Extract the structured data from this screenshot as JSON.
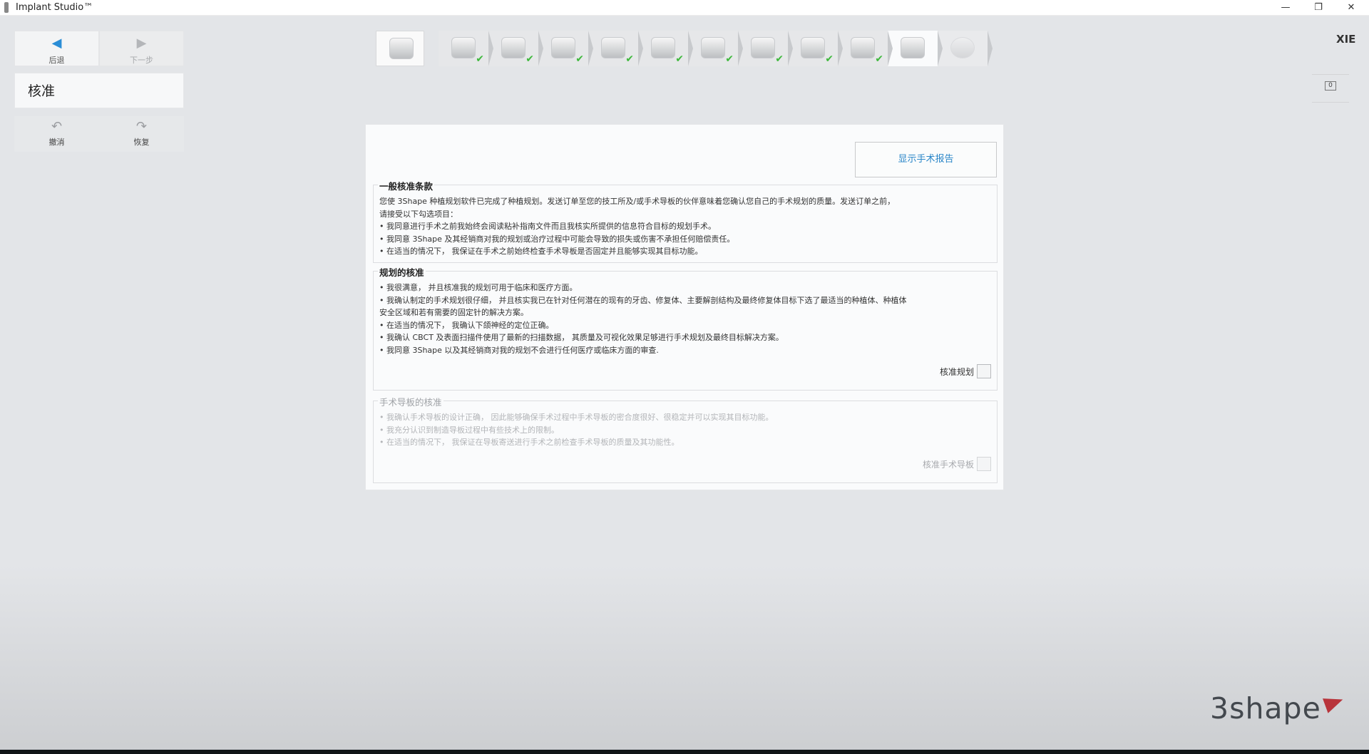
{
  "window": {
    "title": "Implant Studio™",
    "minimize": "—",
    "maximize": "❐",
    "close": "✕"
  },
  "nav": {
    "back_label": "后退",
    "next_label": "下一步",
    "back_icon": "arrow-left-icon",
    "next_icon": "arrow-right-icon"
  },
  "step_title": "核准",
  "edit": {
    "undo_label": "撤消",
    "redo_label": "恢复"
  },
  "workflow": {
    "steps": [
      {
        "name": "case-info",
        "done": false,
        "state": "first"
      },
      {
        "name": "patient-data",
        "done": true
      },
      {
        "name": "scan-import",
        "done": true
      },
      {
        "name": "tooth-model",
        "done": true
      },
      {
        "name": "panoramic",
        "done": true
      },
      {
        "name": "nerve-path",
        "done": true
      },
      {
        "name": "implant-placement",
        "done": true
      },
      {
        "name": "guide-design-1",
        "done": true
      },
      {
        "name": "sleeve",
        "done": true
      },
      {
        "name": "guide-support",
        "done": true
      },
      {
        "name": "approval",
        "done": false,
        "state": "current"
      },
      {
        "name": "export",
        "done": false,
        "state": "disabled"
      }
    ],
    "check_glyph": "✔"
  },
  "user": {
    "initials": "XIE",
    "messages": "0"
  },
  "main": {
    "report_button": "显示手术报告",
    "general": {
      "title": "一般核准条款",
      "lines": [
        "您使 3Shape 种植规划软件已完成了种植规划。发送订单至您的技工所及/或手术导板的伙伴意味着您确认您自己的手术规划的质量。发送订单之前，",
        "请接受以下勾选项目：",
        "• 我同意进行手术之前我始终会阅读粘补指南文件而且我核实所提供的信息符合目标的规划手术。",
        "• 我同意 3Shape 及其经销商对我的规划或治疗过程中可能会导致的损失或伤害不承担任何赔偿责任。",
        "• 在适当的情况下， 我保证在手术之前始终检查手术导板是否固定并且能够实现其目标功能。"
      ]
    },
    "planning": {
      "title": "规划的核准",
      "lines": [
        "• 我很满意， 并且核准我的规划可用于临床和医疗方面。",
        "• 我确认制定的手术规划很仔细， 并且核实我已在针对任何潜在的现有的牙齿、修复体、主要解剖结构及最终修复体目标下选了最适当的种植体、种植体",
        "安全区域和若有需要的固定针的解决方案。",
        "• 在适当的情况下， 我确认下颌神经的定位正确。",
        "• 我确认 CBCT 及表面扫描件使用了最新的扫描数据， 其质量及可视化效果足够进行手术规划及最终目标解决方案。",
        "• 我同意 3Shape 以及其经销商对我的规划不会进行任何医疗或临床方面的审查."
      ],
      "approve_label": "核准规划"
    },
    "guide": {
      "title": "手术导板的核准",
      "lines": [
        "• 我确认手术导板的设计正确， 因此能够确保手术过程中手术导板的密合度很好、很稳定并可以实现其目标功能。",
        "• 我充分认识到制造导板过程中有些技术上的限制。",
        "• 在适当的情况下， 我保证在导板寄送进行手术之前检查手术导板的质量及其功能性。"
      ],
      "approve_label": "核准手术导板"
    }
  },
  "branding": {
    "logo_text": "3shape"
  }
}
